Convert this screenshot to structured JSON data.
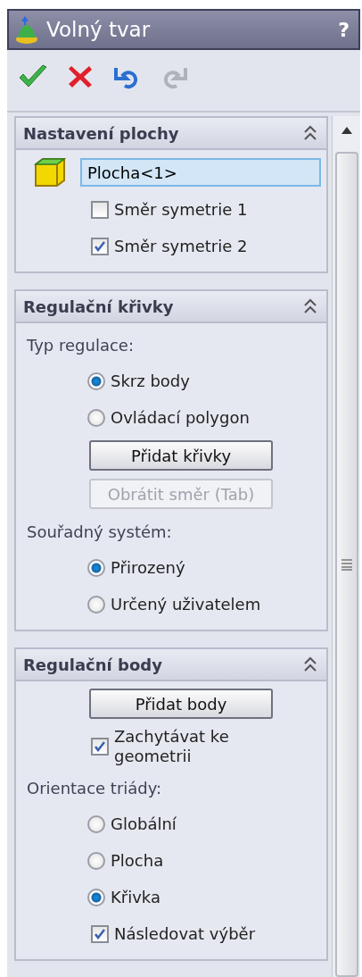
{
  "window": {
    "title": "Volný tvar",
    "help": "?"
  },
  "toolbar": [
    {
      "kind": "ok",
      "disabled": false
    },
    {
      "kind": "cancel",
      "disabled": false
    },
    {
      "kind": "undo",
      "disabled": false
    },
    {
      "kind": "redo",
      "disabled": true
    }
  ],
  "sections": [
    {
      "title": "Nastavení plochy",
      "expanded": true,
      "items": [
        {
          "kind": "field",
          "value": "Plocha<1>"
        },
        {
          "kind": "checkbox",
          "label": "Směr symetrie 1",
          "checked": false
        },
        {
          "kind": "checkbox",
          "label": "Směr symetrie 2",
          "checked": true
        }
      ]
    },
    {
      "title": "Regulační křivky",
      "expanded": true,
      "items": [
        {
          "kind": "label",
          "text": "Typ regulace:"
        },
        {
          "kind": "radio",
          "label": "Skrz body",
          "selected": true
        },
        {
          "kind": "radio",
          "label": "Ovládací polygon",
          "selected": false
        },
        {
          "kind": "button",
          "label": "Přidat křivky",
          "disabled": false
        },
        {
          "kind": "button",
          "label": "Obrátit směr (Tab)",
          "disabled": true
        },
        {
          "kind": "label",
          "text": "Souřadný systém:"
        },
        {
          "kind": "radio",
          "label": "Přirozený",
          "selected": true
        },
        {
          "kind": "radio",
          "label": "Určený uživatelem",
          "selected": false
        }
      ]
    },
    {
      "title": "Regulační body",
      "expanded": true,
      "items": [
        {
          "kind": "button",
          "label": "Přidat body",
          "disabled": false
        },
        {
          "kind": "checkbox",
          "label": "Zachytávat ke geometrii",
          "checked": true
        },
        {
          "kind": "label",
          "text": "Orientace triády:"
        },
        {
          "kind": "radio",
          "label": "Globální",
          "selected": false
        },
        {
          "kind": "radio",
          "label": "Plocha",
          "selected": false
        },
        {
          "kind": "radio",
          "label": "Křivka",
          "selected": true
        },
        {
          "kind": "checkbox",
          "label": "Následovat výběr",
          "checked": true
        }
      ]
    }
  ]
}
